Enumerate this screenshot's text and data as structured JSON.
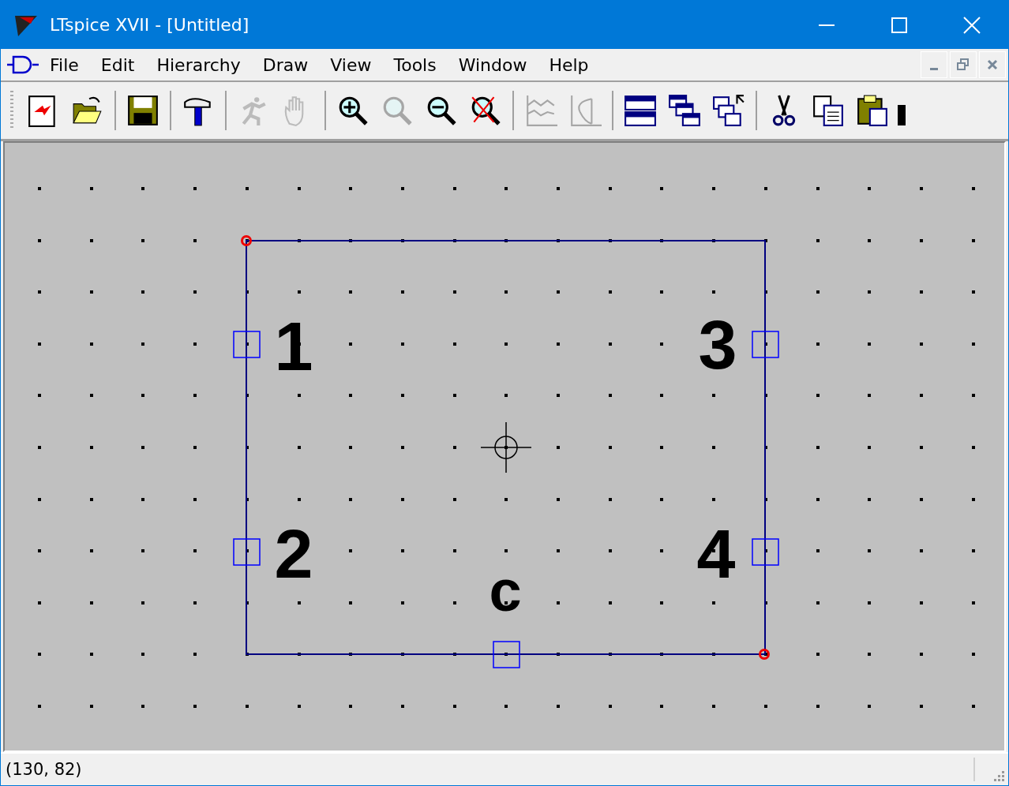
{
  "window": {
    "title": "LTspice XVII - [Untitled]"
  },
  "menu": [
    {
      "label": "File"
    },
    {
      "label": "Edit"
    },
    {
      "label": "Hierarchy"
    },
    {
      "label": "Draw"
    },
    {
      "label": "View"
    },
    {
      "label": "Tools"
    },
    {
      "label": "Window"
    },
    {
      "label": "Help"
    }
  ],
  "toolbar": [
    [
      {
        "kind": "new",
        "disabled": false
      },
      {
        "kind": "open",
        "disabled": false
      }
    ],
    [
      {
        "kind": "save",
        "disabled": false
      }
    ],
    [
      {
        "kind": "hammer",
        "disabled": false
      }
    ],
    [
      {
        "kind": "run",
        "disabled": true
      },
      {
        "kind": "halt",
        "disabled": true
      }
    ],
    [
      {
        "kind": "zoomin",
        "disabled": false
      },
      {
        "kind": "pan",
        "disabled": true
      },
      {
        "kind": "zoomout",
        "disabled": false
      },
      {
        "kind": "zoomfit",
        "disabled": false
      }
    ],
    [
      {
        "kind": "autorange",
        "disabled": true
      },
      {
        "kind": "fft",
        "disabled": true
      }
    ],
    [
      {
        "kind": "tile",
        "disabled": false
      },
      {
        "kind": "cascade",
        "disabled": false
      },
      {
        "kind": "closeall",
        "disabled": false
      }
    ],
    [
      {
        "kind": "cut",
        "disabled": false
      },
      {
        "kind": "copy",
        "disabled": false
      },
      {
        "kind": "paste",
        "disabled": false
      }
    ]
  ],
  "symbol": {
    "pins": [
      {
        "label": "1"
      },
      {
        "label": "2"
      },
      {
        "label": "3"
      },
      {
        "label": "4"
      },
      {
        "label": "c"
      }
    ]
  },
  "status_bar": {
    "text": "(130, 82)"
  }
}
